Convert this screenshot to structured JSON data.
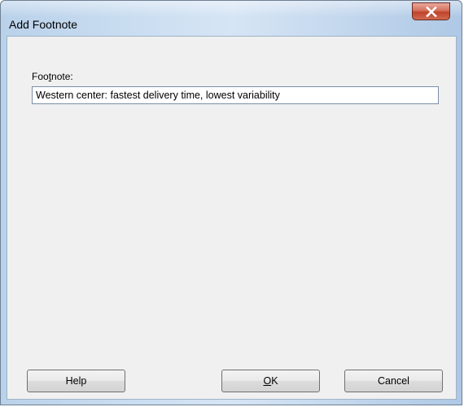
{
  "window": {
    "title": "Add Footnote",
    "close_label": "x"
  },
  "form": {
    "label_prefix": "Foo",
    "label_underlined": "t",
    "label_suffix": "note:",
    "value": "Western center: fastest delivery time, lowest variability"
  },
  "buttons": {
    "help": "Help",
    "ok_underlined": "O",
    "ok_rest": "K",
    "cancel": "Cancel"
  },
  "icons": {
    "close": "close-icon"
  }
}
